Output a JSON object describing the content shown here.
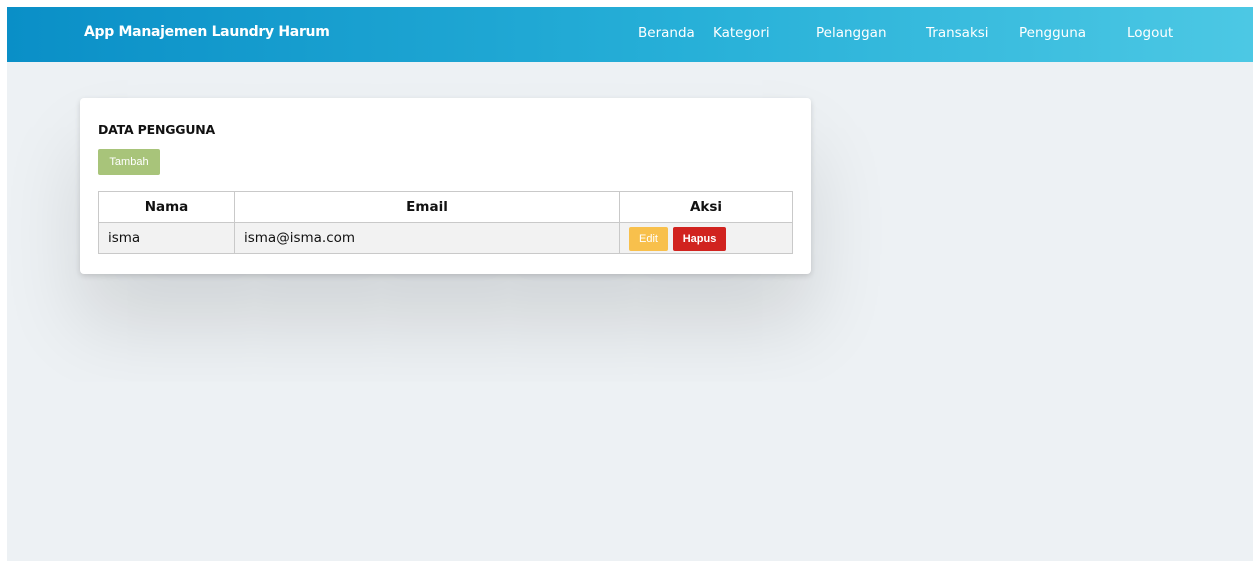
{
  "navbar": {
    "brand": "App Manajemen Laundry Harum",
    "items": [
      "Beranda",
      "Kategori",
      "Pelanggan",
      "Transaksi",
      "Pengguna",
      "Logout"
    ]
  },
  "card": {
    "title": "DATA PENGGUNA",
    "add_label": "Tambah",
    "columns": [
      "Nama",
      "Email",
      "Aksi"
    ],
    "rows": [
      {
        "name": "isma",
        "email": "isma@isma.com",
        "edit_label": "Edit",
        "delete_label": "Hapus"
      }
    ]
  },
  "colors": {
    "navbar_start": "#0a8fc7",
    "navbar_end": "#4cc8e4",
    "add_button": "#a8c47a",
    "edit_button": "#f8c04c",
    "delete_button": "#d1231f",
    "page_background": "#edf1f4"
  }
}
